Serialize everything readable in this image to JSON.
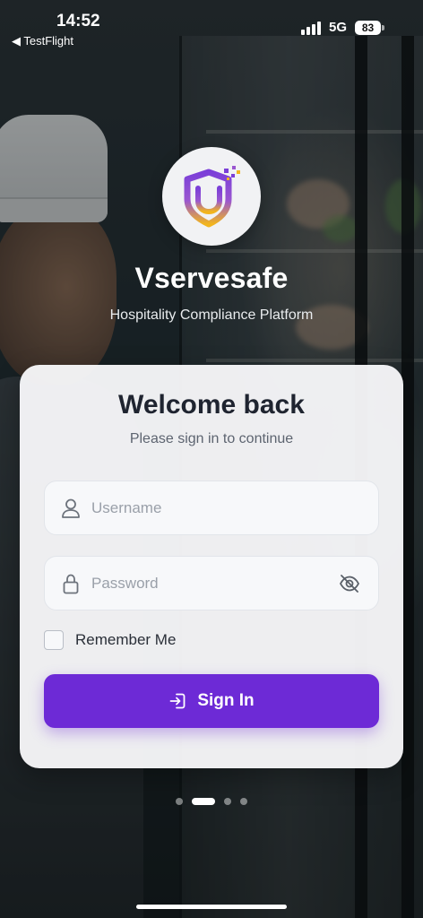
{
  "status_bar": {
    "time": "14:52",
    "back_app": "◀ TestFlight",
    "network": "5G",
    "battery": "83"
  },
  "brand": {
    "name": "Vservesafe",
    "tagline": "Hospitality Compliance Platform",
    "logo_icon": "shield-logo-icon",
    "logo_colors": [
      "#7a3fd6",
      "#f2b51d"
    ]
  },
  "login": {
    "title": "Welcome back",
    "subtitle": "Please sign in to continue",
    "username_placeholder": "Username",
    "password_placeholder": "Password",
    "remember_label": "Remember Me",
    "remember_checked": false,
    "signin_label": "Sign In",
    "accent_color": "#6d2ad6"
  },
  "pager": {
    "total": 4,
    "active_index": 1
  }
}
